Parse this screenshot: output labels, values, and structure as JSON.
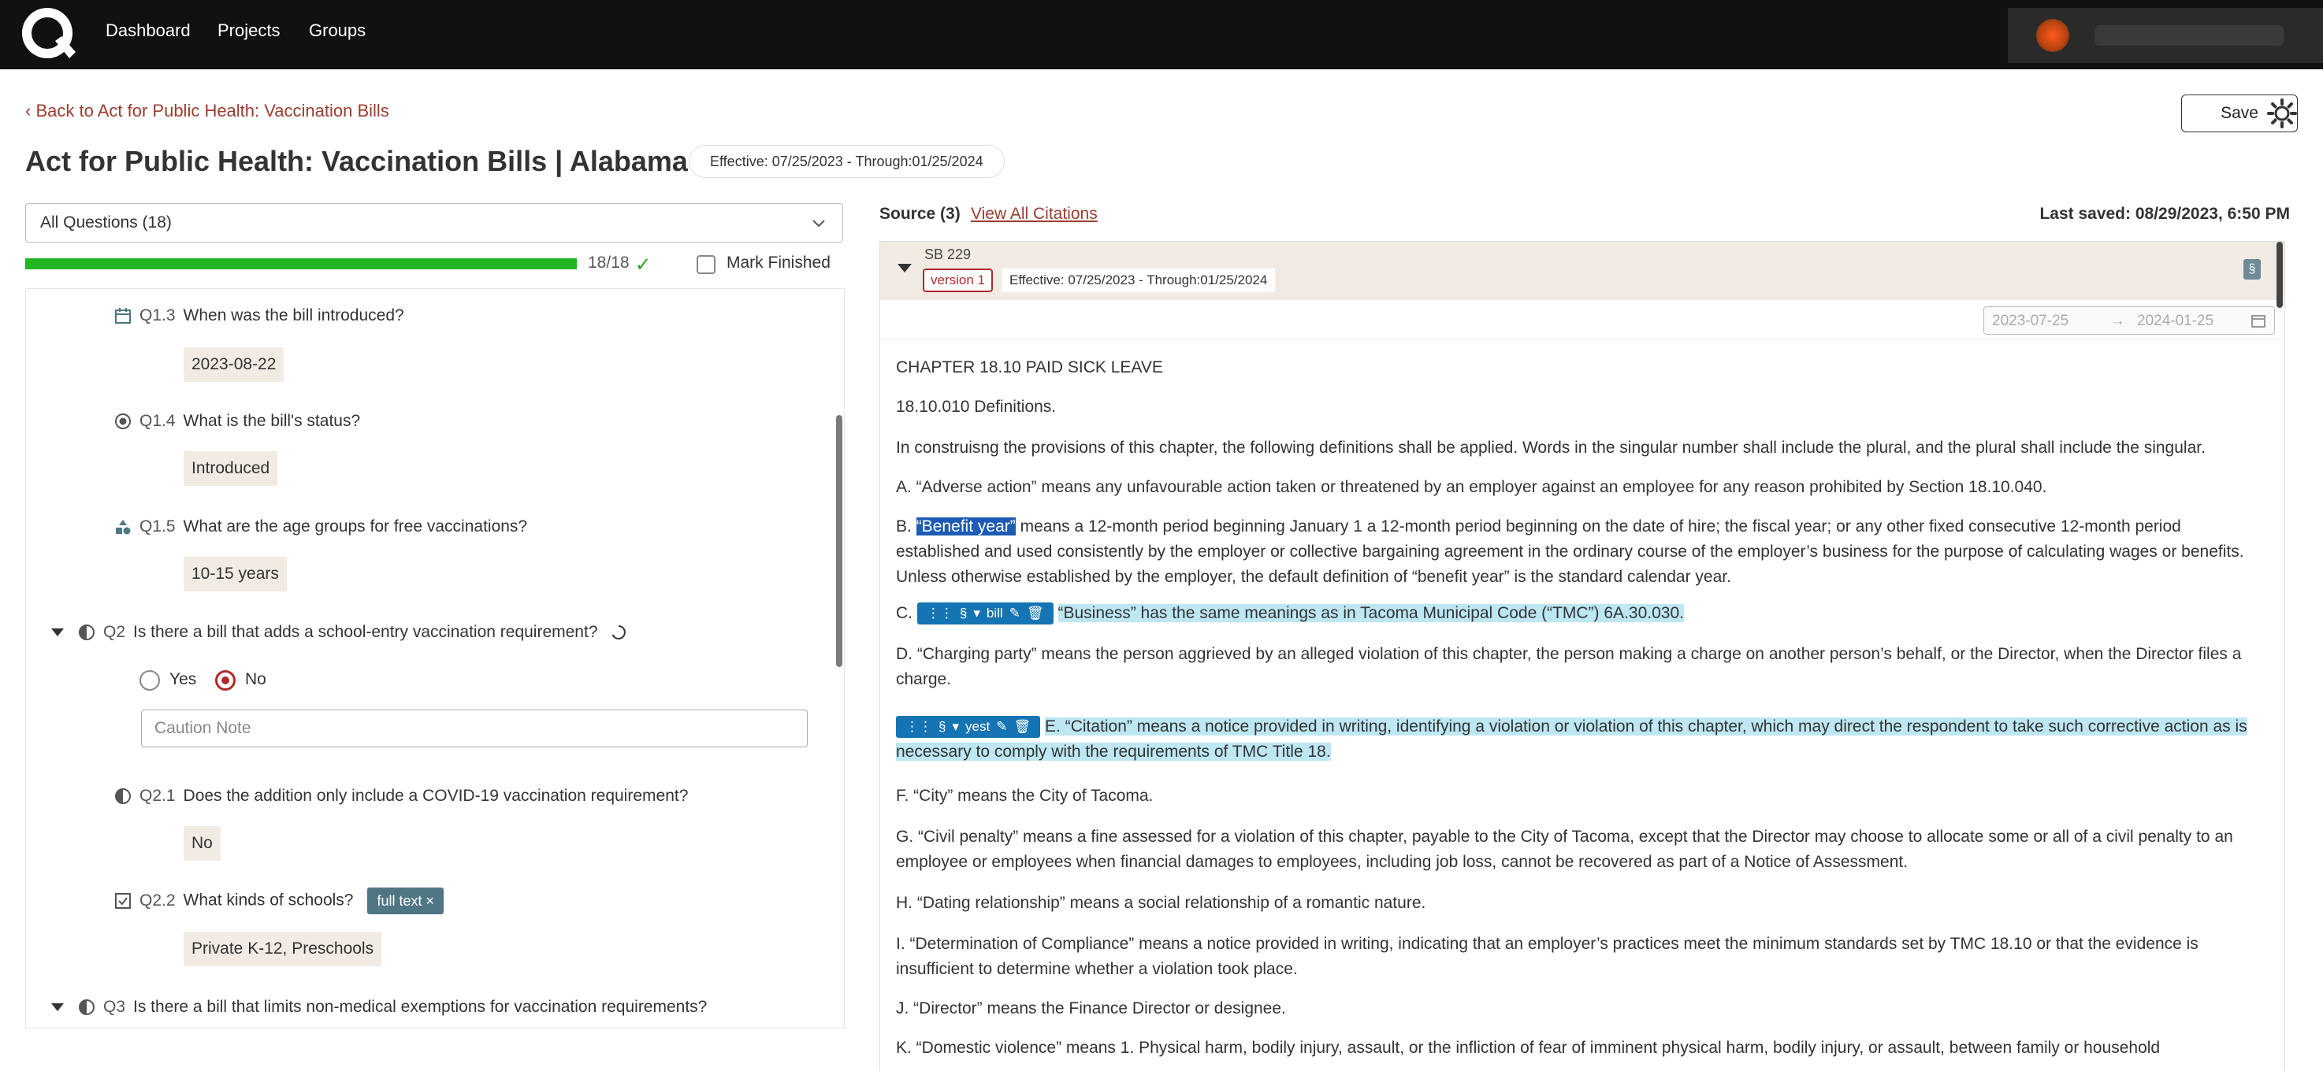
{
  "nav": {
    "items": [
      "Dashboard",
      "Projects",
      "Groups"
    ]
  },
  "header": {
    "back_link": "Back to Act for Public Health: Vaccination Bills",
    "title": "Act for Public Health: Vaccination Bills | Alabama",
    "effective": "Effective: 07/25/2023 - Through:01/25/2024",
    "save_label": "Save"
  },
  "left": {
    "question_filter": "All Questions (18)",
    "progress": {
      "done": 18,
      "total": 18,
      "text": "18/18"
    },
    "mark_finished_label": "Mark Finished",
    "mark_finished_checked": false,
    "questions": [
      {
        "num": "Q1.3",
        "text": "When was the bill introduced?",
        "answer": "2023-08-22",
        "icon": "calendar-icon"
      },
      {
        "num": "Q1.4",
        "text": "What is the bill's status?",
        "answer": "Introduced",
        "icon": "radio-icon"
      },
      {
        "num": "Q1.5",
        "text": "What are the age groups for free vaccinations?",
        "answer": "10-15 years",
        "icon": "category-icon"
      },
      {
        "num": "Q2",
        "text": "Is there a bill that adds a school-entry vaccination requirement?",
        "icon": "half-circle-icon"
      },
      {
        "num": "Q2.1",
        "text": "Does the addition only include a COVID-19 vaccination requirement?",
        "answer": "No",
        "icon": "half-circle-icon"
      },
      {
        "num": "Q2.2",
        "text": "What kinds of schools?",
        "answer": "Private K-12, Preschools",
        "tag": "full text ×",
        "icon": "checkbox-icon"
      },
      {
        "num": "Q3",
        "text": "Is there a bill that limits non-medical exemptions for vaccination requirements?",
        "icon": "half-circle-icon"
      }
    ],
    "q2_options": [
      "Yes",
      "No"
    ],
    "q2_selected": "No",
    "caution_placeholder": "Caution Note"
  },
  "right": {
    "source_label": "Source (3)",
    "view_citations": "View All Citations",
    "last_saved_label": "Last saved:",
    "last_saved_value": "08/29/2023, 6:50 PM",
    "doc_id": "SB 229",
    "version": "version 1",
    "effective": "Effective: 07/25/2023 - Through:01/25/2024",
    "date_from": "2023-07-25",
    "date_to": "2024-01-25",
    "section_icon_text": "§",
    "citation_tags": [
      {
        "symbol": "§",
        "label": "bill"
      },
      {
        "symbol": "§",
        "label": "yest"
      }
    ],
    "doc": {
      "chapter": "CHAPTER 18.10 PAID SICK LEAVE",
      "section": "18.10.010 Definitions.",
      "p_intro": "In construisng the provisions of this chapter, the following definitions shall be applied. Words in the singular number shall include the plural, and the plural shall include the singular.",
      "p_a": "A. “Adverse action” means any unfavourable action taken or threatened by an employer against an employee for any reason prohibited by Section 18.10.040.",
      "p_b_prefix": "B.",
      "p_b_selected": "“Benefit year”",
      "p_b_rest": " means a 12-month period beginning January 1 a 12-month period beginning on the date of hire; the fiscal year; or any other fixed consecutive 12-month period established and used consistently by the employer or collective bargaining agreement in the ordinary course of the employer’s business for the purpose of calculating wages or benefits. Unless otherwise established by the employer, the default definition of “benefit year” is the standard calendar year.",
      "p_c_prefix": "C.",
      "p_c_highlight": "“Business” has the same meanings as in Tacoma Municipal Code (“TMC”) 6A.30.030.",
      "p_d": "D. “Charging party” means the person aggrieved by an alleged violation of this chapter, the person making a charge on another person’s behalf, or the Director, when the Director files a charge.",
      "p_e_highlight": "E. “Citation” means a notice provided in writing, identifying a violation or violation of this chapter, which may direct the respondent to take such corrective action as is necessary to comply with the requirements of TMC Title 18.",
      "p_f": "F. “City” means the City of Tacoma.",
      "p_g": "G. “Civil penalty” means a fine assessed for a violation of this chapter, payable to the City of Tacoma, except that the Director may choose to allocate some or all of a civil penalty to an employee or employees when financial damages to employees, including job loss, cannot be recovered as part of a Notice of Assessment.",
      "p_h": "H. “Dating relationship” means a social relationship of a romantic nature.",
      "p_i": "I. “Determination of Compliance” means a notice provided in writing, indicating that an employer’s practices meet the minimum standards set by TMC 18.10 or that the evidence is insufficient to determine whether a violation took place.",
      "p_j": "J. “Director” means the Finance Director or designee.",
      "p_k": "K. “Domestic violence” means 1. Physical harm, bodily injury, assault, or the infliction of fear of imminent physical harm, bodily injury, or assault, between family or household"
    }
  },
  "colors": {
    "topbar": "#111111",
    "accent_link": "#9b3d2f",
    "progress": "#21b521",
    "highlight": "#bde7f3",
    "citation_tag": "#1574b3",
    "selected_radio": "#b02a2a"
  }
}
